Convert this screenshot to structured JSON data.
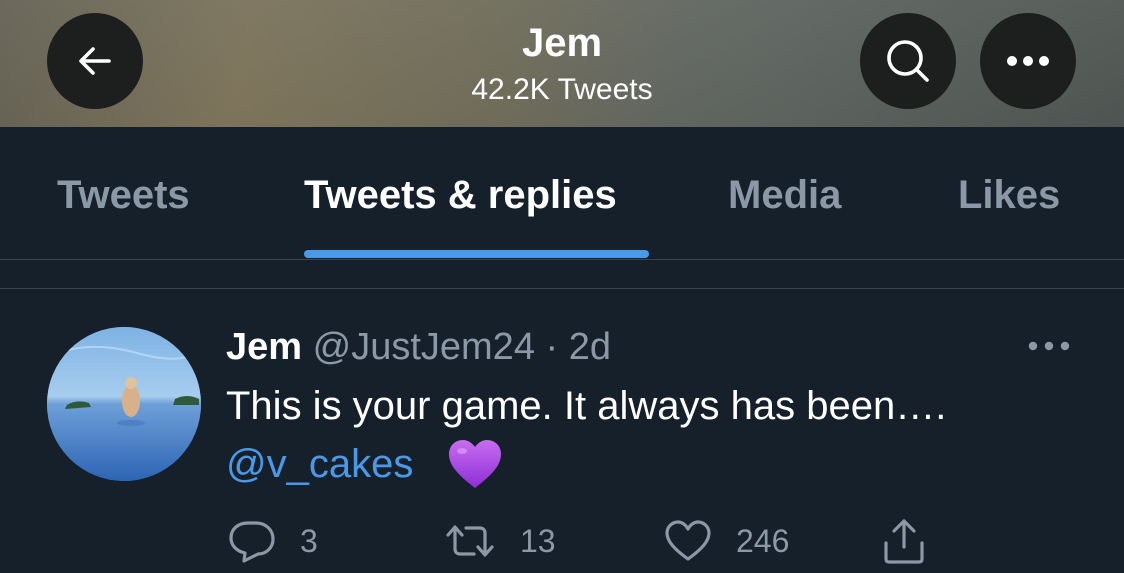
{
  "header": {
    "title": "Jem",
    "subtitle": "42.2K Tweets",
    "back_icon": "arrow-left-icon",
    "search_icon": "search-icon",
    "more_icon": "more-horizontal-icon"
  },
  "tabs": [
    {
      "label": "Tweets",
      "active": false
    },
    {
      "label": "Tweets & replies",
      "active": true
    },
    {
      "label": "Media",
      "active": false
    },
    {
      "label": "Likes",
      "active": false
    }
  ],
  "tweet": {
    "name": "Jem",
    "handle": "@JustJem24",
    "separator": "·",
    "time": "2d",
    "text": "This is your game. It always has been….",
    "mention": "@v_cakes",
    "emoji": "purple-heart",
    "replies": "3",
    "retweets": "13",
    "likes": "246"
  },
  "colors": {
    "background": "#15202b",
    "accent": "#4a99e9",
    "muted": "#8b98a5",
    "border": "#38444d"
  }
}
